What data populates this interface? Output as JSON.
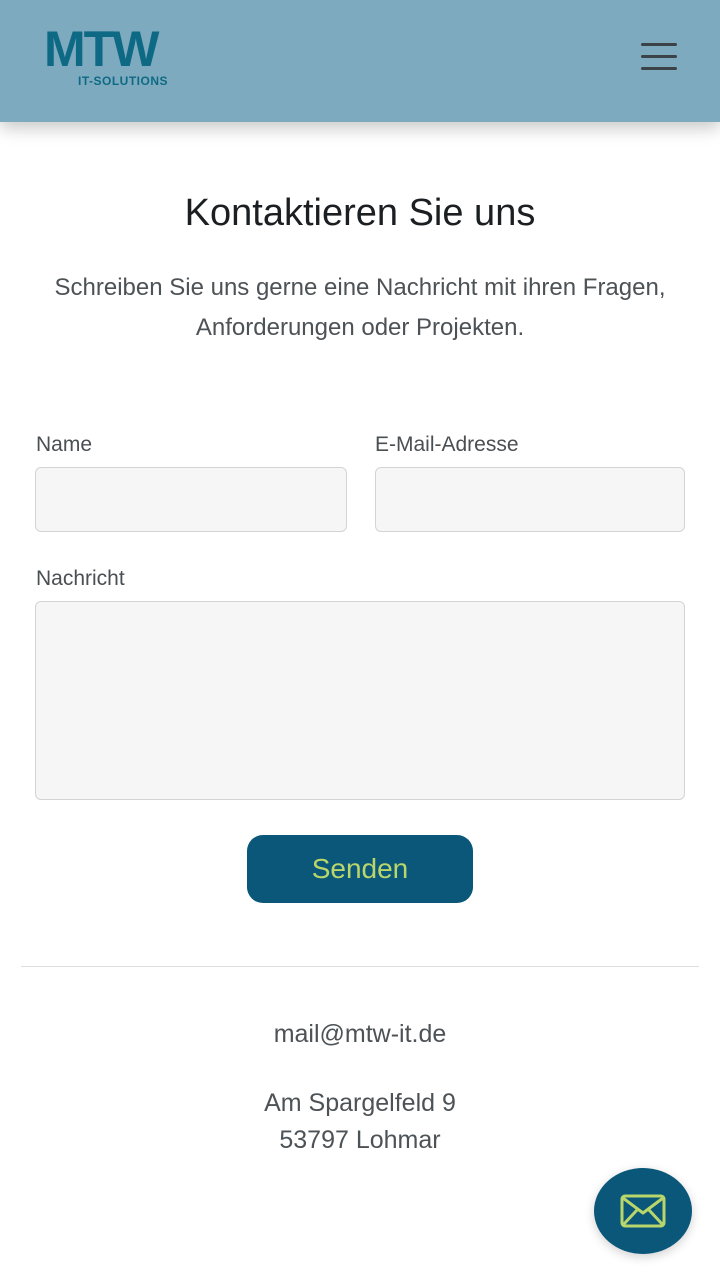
{
  "header": {
    "logo_text": "MTW",
    "logo_subtext": "IT-SOLUTIONS",
    "menu_icon": "hamburger-menu-icon"
  },
  "contact": {
    "title": "Kontaktieren Sie uns",
    "subtitle": "Schreiben Sie uns gerne eine Nachricht mit ihren Fragen, Anforderungen oder Projekten.",
    "form": {
      "name_label": "Name",
      "name_value": "",
      "email_label": "E-Mail-Adresse",
      "email_value": "",
      "message_label": "Nachricht",
      "message_value": "",
      "submit_label": "Senden"
    }
  },
  "footer": {
    "email": "mail@mtw-it.de",
    "address_line1": "Am Spargelfeld 9",
    "address_line2": "53797 Lohmar"
  },
  "fab": {
    "icon": "envelope-icon"
  },
  "colors": {
    "header_bg": "#7eaabf",
    "brand_dark": "#0b5779",
    "logo_blue": "#0e6a84",
    "button_text": "#b9d66a"
  }
}
